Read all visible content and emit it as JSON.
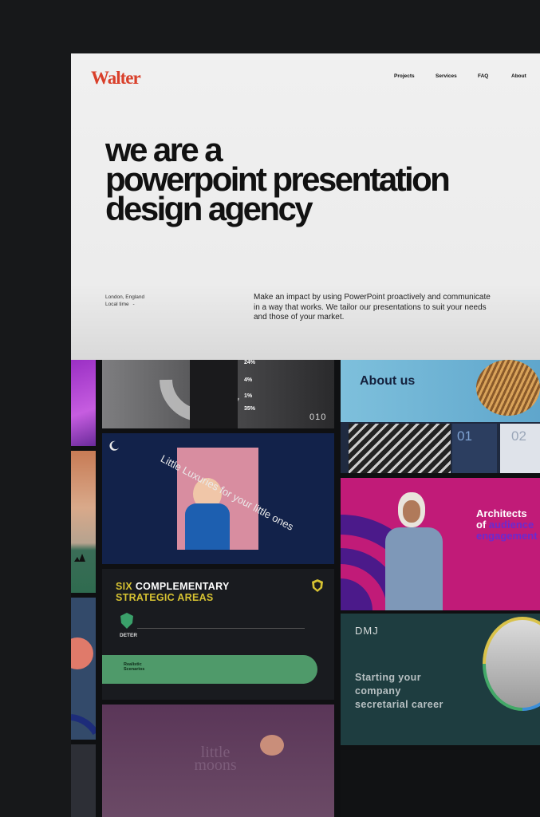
{
  "brand": {
    "logo": "Walter",
    "accent": "#d9402b"
  },
  "nav": {
    "items": [
      "Projects",
      "Services",
      "FAQ",
      "About"
    ]
  },
  "hero": {
    "headline_lines": [
      "we are a",
      "powerpoint presentation",
      "design agency"
    ],
    "location": "London, England",
    "local_time_label": "Local time",
    "local_time_sep": "-",
    "intro": "Make an impact by using PowerPoint proactively and communicate in a way that works. We tailor our presentations to suit your needs and those of your market."
  },
  "portfolio": {
    "stats_slide": {
      "values": [
        "24%",
        "4%",
        "1%",
        "35%"
      ],
      "page": "010"
    },
    "luxuries_slide": {
      "arc_text": "Little Luxuries for your little ones"
    },
    "strategic_slide": {
      "title_accent": "SIX",
      "title_main": "COMPLEMENTARY",
      "title_line2": "STRATEGIC AREAS",
      "step_label": "DETER",
      "bar_label": "Realistic Scenarios"
    },
    "moons_slide": {
      "title": "little moons"
    },
    "about_slide": {
      "title": "About us",
      "numbers": [
        "01",
        "02"
      ]
    },
    "architects_slide": {
      "line1": "Architects",
      "line2_prefix": "of ",
      "line2_accent": "audience",
      "line3": "engagement"
    },
    "dmj_slide": {
      "logo": "DMJ",
      "tagline": [
        "Starting your",
        "company",
        "secretarial career"
      ]
    }
  }
}
